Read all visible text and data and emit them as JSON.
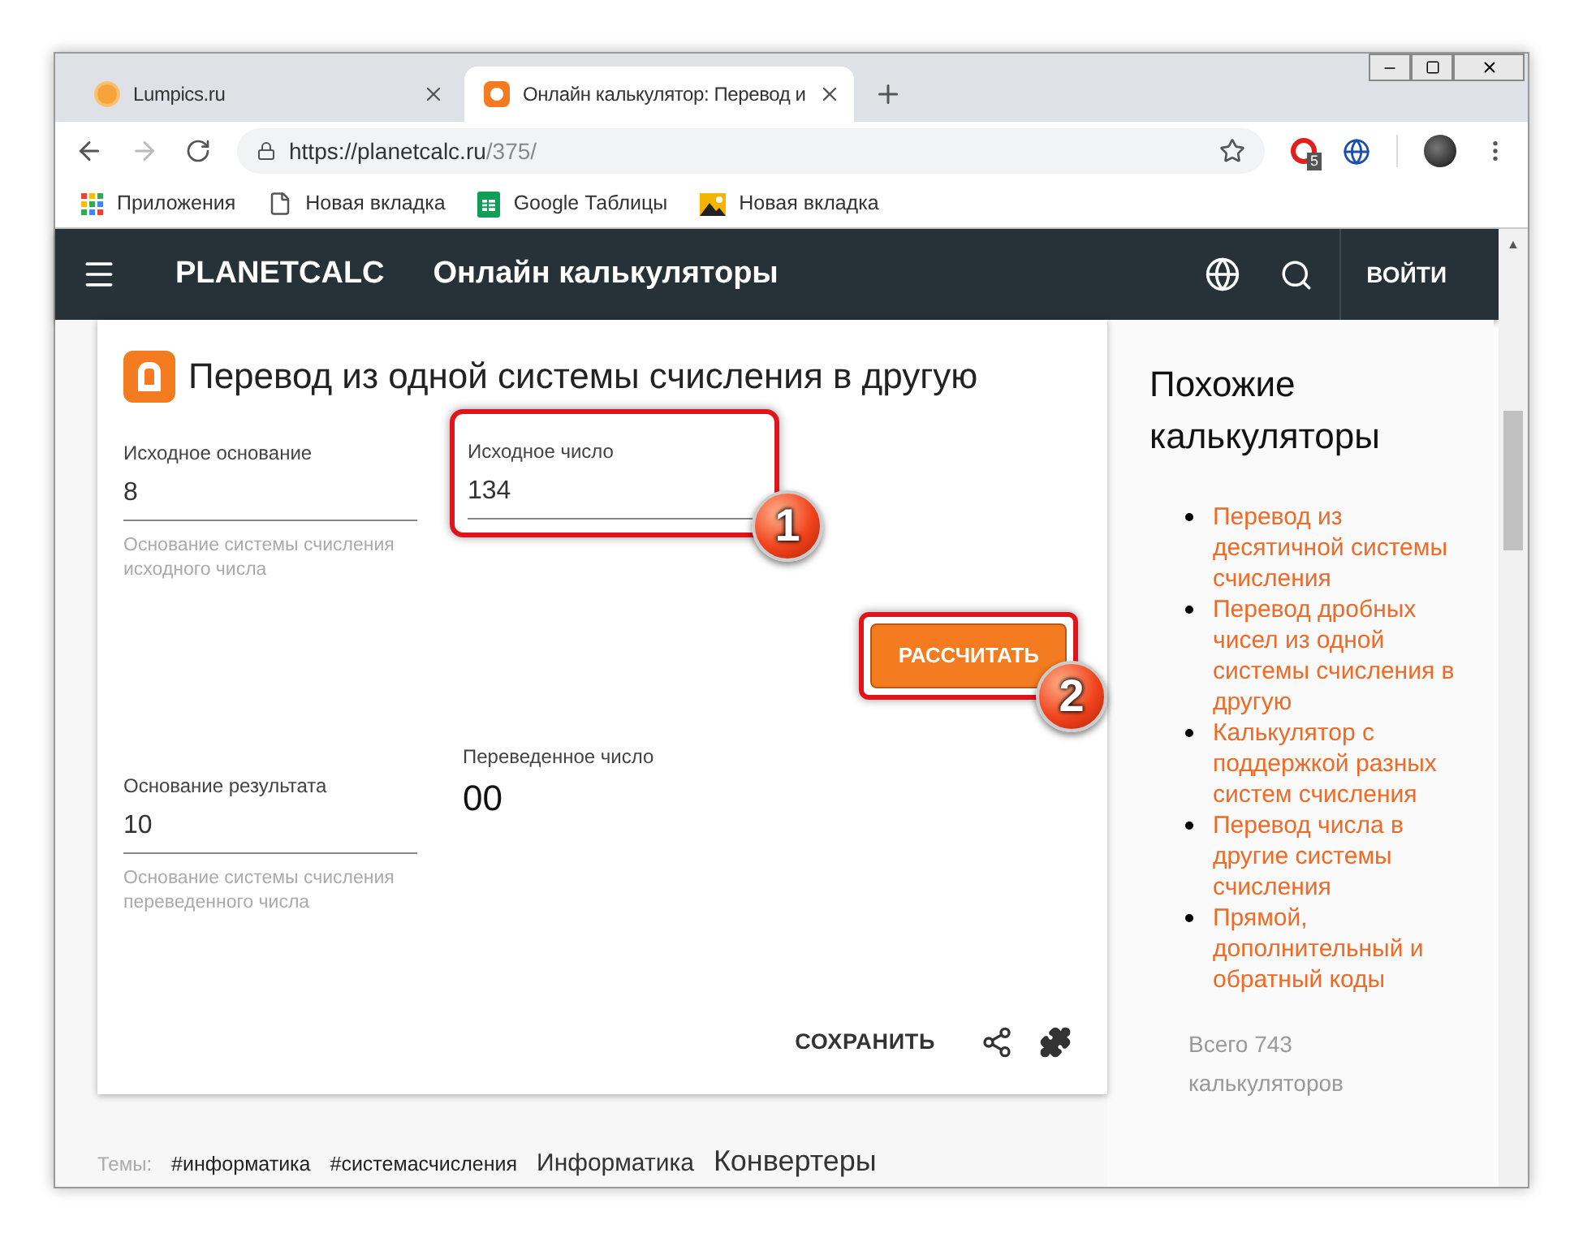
{
  "browser": {
    "tabs": [
      {
        "label": "Lumpics.ru",
        "selected": false,
        "kind": "fruit"
      },
      {
        "label": "Онлайн калькулятор: Перевод и",
        "selected": true,
        "kind": "logo"
      }
    ],
    "url": {
      "host": "https://planetcalc.ru",
      "path": "/375/"
    },
    "extension_badge": "5",
    "bookmarks": [
      {
        "label": "Приложения",
        "kind": "apps"
      },
      {
        "label": "Новая вкладка",
        "kind": "page"
      },
      {
        "label": "Google Таблицы",
        "kind": "sheet"
      },
      {
        "label": "Новая вкладка",
        "kind": "image"
      }
    ]
  },
  "scroll_up": "▲",
  "header": {
    "brand": "PLANETCALC",
    "title": "Онлайн калькуляторы",
    "login": "ВОЙТИ"
  },
  "calculator": {
    "title": "Перевод из одной системы счисления в другую",
    "source_base": {
      "label": "Исходное основание",
      "value": "8",
      "hint": "Основание системы счисления исходного числа"
    },
    "source_number": {
      "label": "Исходное число",
      "value": "134",
      "highlighted": true,
      "marker": "1"
    },
    "calculate": {
      "label": "РАССЧИТАТЬ",
      "highlighted": true,
      "marker": "2"
    },
    "result_base": {
      "label": "Основание результата",
      "value": "10",
      "hint": "Основание системы счисления переведенного числа"
    },
    "result": {
      "label": "Переведенное число",
      "value": "00"
    },
    "save": "СОХРАНИТЬ"
  },
  "tags": {
    "label": "Темы:",
    "items": [
      {
        "label": "#информатика",
        "kind": "hashtag"
      },
      {
        "label": "#системасчисления",
        "kind": "hashtag"
      },
      {
        "label": "Информатика",
        "kind": "category"
      },
      {
        "label": "Конвертеры",
        "kind": "category-large"
      }
    ]
  },
  "sidebar": {
    "title": "Похожие калькуляторы",
    "items": [
      "Перевод из десятичной системы счисления",
      "Перевод дробных чисел из одной системы счисления в другую",
      "Калькулятор с поддержкой разных систем счисления",
      "Перевод числа в другие системы счисления",
      "Прямой, дополнительный и обратный коды"
    ],
    "total": "Всего 743 калькуляторов"
  }
}
